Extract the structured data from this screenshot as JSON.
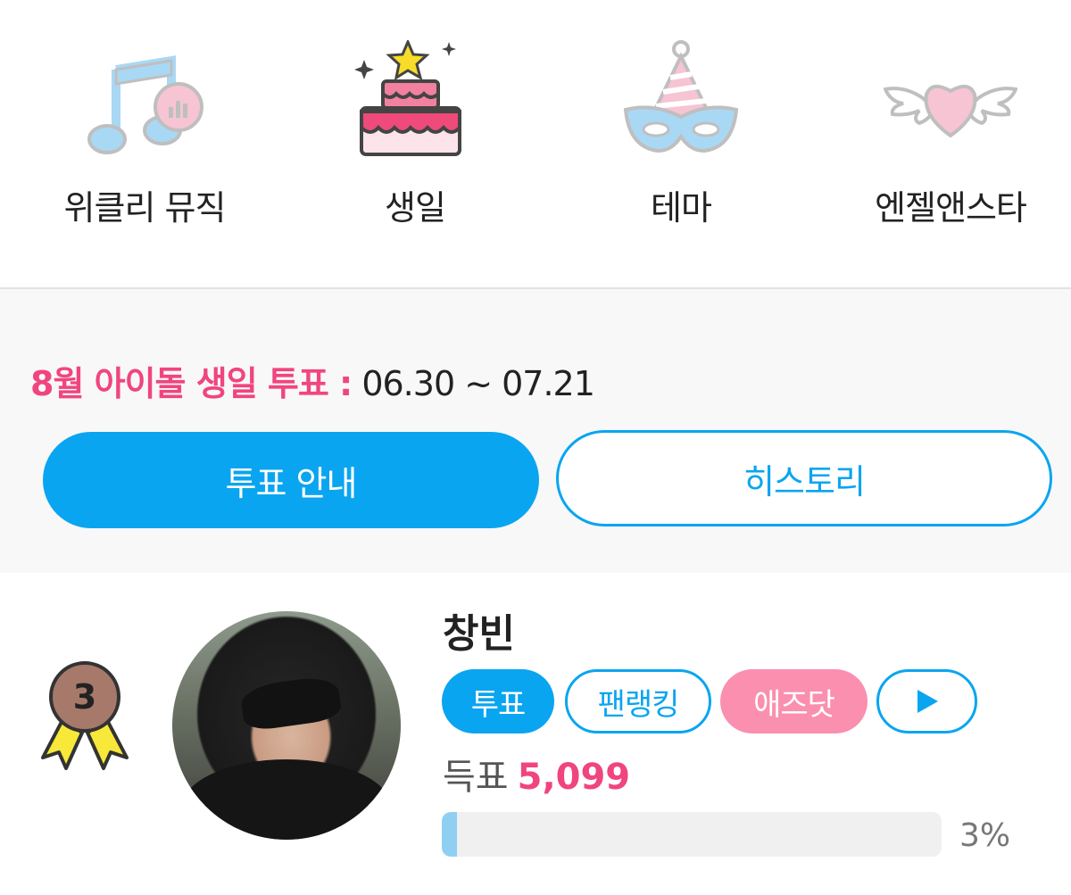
{
  "categories": [
    {
      "label": "위클리 뮤직",
      "icon": "music-note-chart-icon"
    },
    {
      "label": "생일",
      "icon": "birthday-cake-icon"
    },
    {
      "label": "테마",
      "icon": "party-hat-mask-icon"
    },
    {
      "label": "엔젤앤스타",
      "icon": "winged-heart-icon"
    }
  ],
  "vote": {
    "title": "8월 아이돌 생일 투표 :",
    "dates": " 06.30 ~ 07.21",
    "guide_button": "투표 안내",
    "history_button": "히스토리"
  },
  "ranking": {
    "rank": "3",
    "name": "창빈",
    "actions": {
      "vote": "투표",
      "fan_ranking": "팬랭킹",
      "ads": "애즈닷"
    },
    "votes_label": "득표",
    "votes_value": "5,099",
    "percent": "3%",
    "progress_fraction": 0.03
  },
  "colors": {
    "accent_blue": "#0aa5f0",
    "accent_pink": "#f0457e",
    "pill_pink": "#fb8fb0"
  }
}
